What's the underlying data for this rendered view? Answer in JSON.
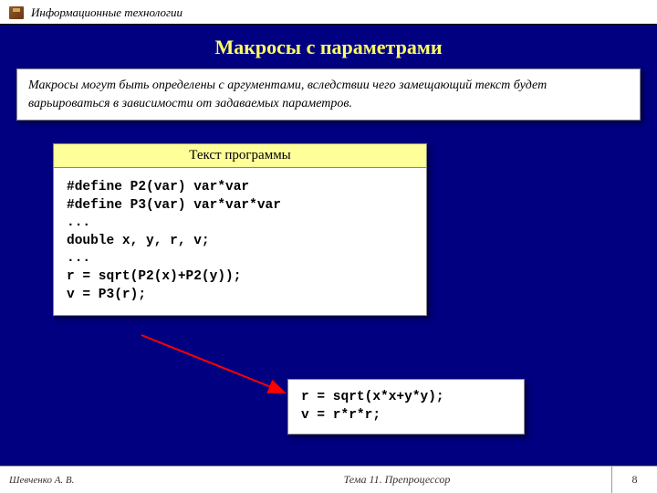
{
  "header": {
    "text": "Информационные технологии"
  },
  "slide": {
    "title": "Макросы с параметрами",
    "intro": "Макросы могут быть определены с аргументами, вследствии чего замещающий текст будет варьироваться в зависимости от задаваемых параметров.",
    "codeBoxTitle": "Текст программы",
    "code": "#define P2(var) var*var\n#define P3(var) var*var*var\n...\ndouble x, y, r, v;\n...\nr = sqrt(P2(x)+P2(y));\nv = P3(r);",
    "result": "r = sqrt(x*x+y*y);\nv = r*r*r;"
  },
  "footer": {
    "author": "Шевченко А. В.",
    "topic": "Тема 11. Препроцессор",
    "page": "8"
  }
}
